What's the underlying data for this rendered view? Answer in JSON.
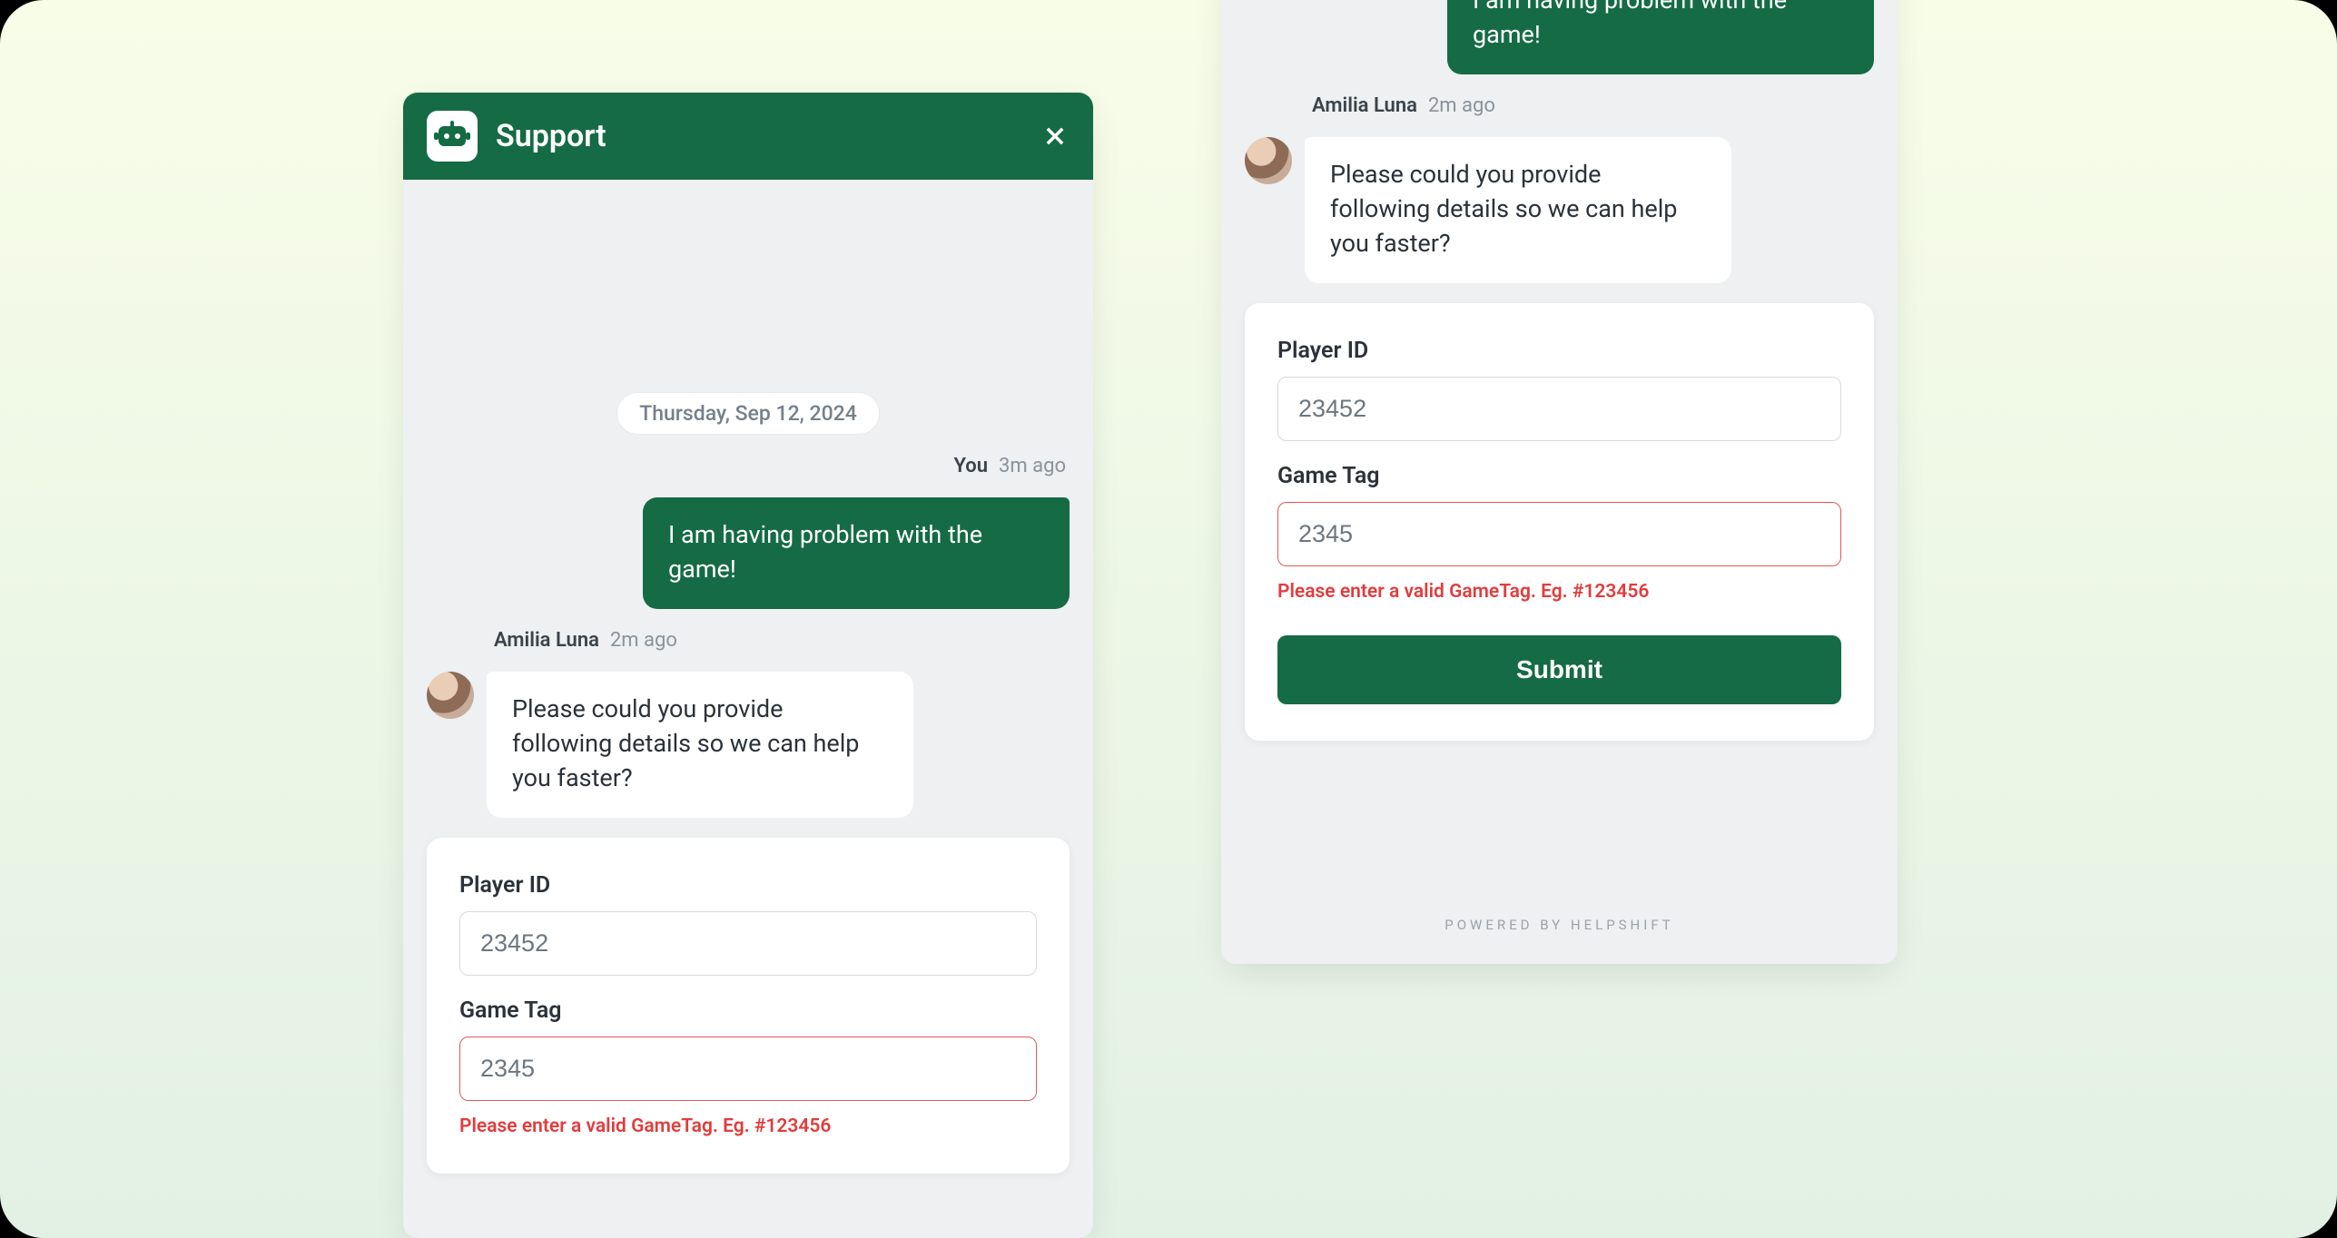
{
  "header": {
    "title": "Support"
  },
  "chat": {
    "date": "Thursday, Sep 12, 2024",
    "user_meta_name": "You",
    "user_meta_time": "3m ago",
    "user_bubble": "I am having problem with the game!",
    "agent_name": "Amilia Luna",
    "agent_time": "2m ago",
    "agent_bubble": "Please could you provide following details so we can help you faster?"
  },
  "form": {
    "player_id_label": "Player ID",
    "player_id_value": "23452",
    "game_tag_label": "Game Tag",
    "game_tag_value": "2345",
    "game_tag_error": "Please enter a valid GameTag. Eg. #123456",
    "submit_label": "Submit"
  },
  "footer": {
    "powered": "Powered by Helpshift"
  }
}
